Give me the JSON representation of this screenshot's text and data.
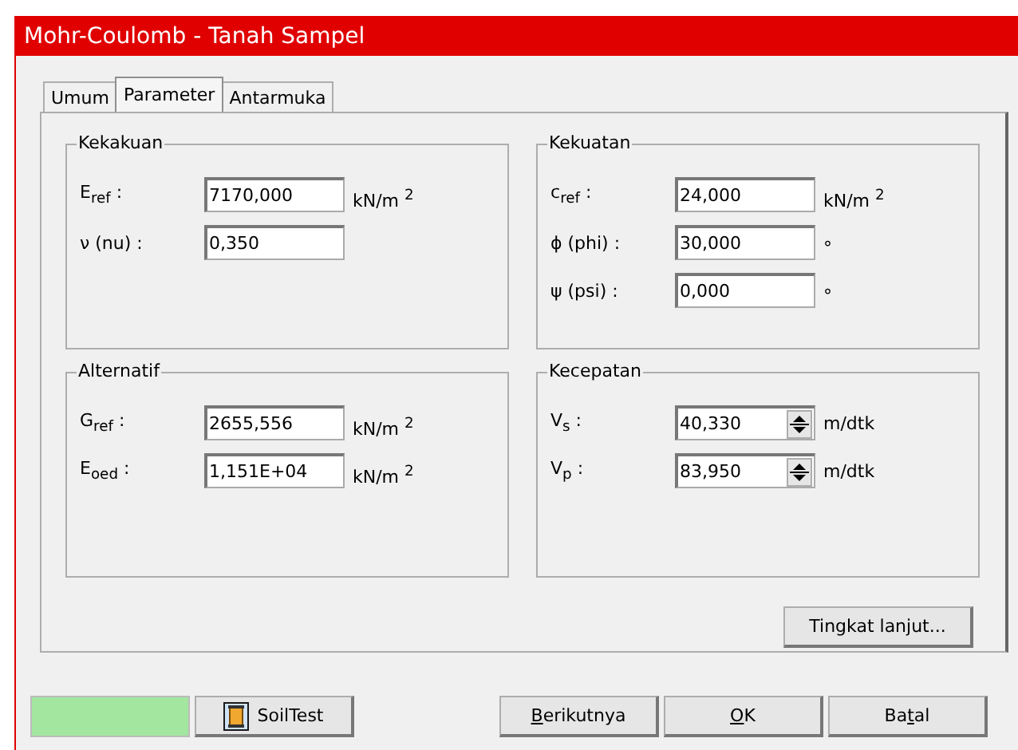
{
  "window": {
    "title": "Mohr-Coulomb - Tanah Sampel"
  },
  "tabs": [
    {
      "label": "Umum",
      "selected": false
    },
    {
      "label": "Parameter",
      "selected": true
    },
    {
      "label": "Antarmuka",
      "selected": false
    }
  ],
  "groups": [
    {
      "title": "Kekakuan",
      "fields": [
        {
          "kind": "text",
          "label": "E$_{ref}$ :",
          "value": "7170,000",
          "unit": "kN/m $^{2}$"
        },
        {
          "kind": "text",
          "label": "ν (nu) :",
          "value": "0,350"
        }
      ]
    },
    {
      "title": "Kekuatan",
      "fields": [
        {
          "kind": "text",
          "label": "c$_{ref}$ :",
          "value": "24,000",
          "unit": "kN/m $^{2}$"
        },
        {
          "kind": "text",
          "label": "ϕ (phi) :",
          "value": "30,000",
          "unit": "°"
        },
        {
          "kind": "text",
          "label": "ψ (psi) :",
          "value": "0,000",
          "unit": "°"
        }
      ]
    },
    {
      "title": "Alternatif",
      "fields": [
        {
          "kind": "text",
          "label": "G$_{ref}$ :",
          "value": "2655,556",
          "unit": "kN/m $^{2}$"
        },
        {
          "kind": "text",
          "label": "E$_{oed}$ :",
          "value": "1,151E+04",
          "unit": "kN/m $^{2}$"
        }
      ]
    },
    {
      "title": "Kecepatan",
      "fields": [
        {
          "kind": "spin",
          "label": "V$_{s}$ :",
          "value": "40,330",
          "unit": "m/dtk"
        },
        {
          "kind": "spin",
          "label": "V$_{p}$ :",
          "value": "83,950",
          "unit": "m/dtk"
        }
      ]
    }
  ],
  "advanced_button": "Tingkat lanjut...",
  "swatch": {
    "color": "#a3e6a0"
  },
  "soiltest_button": "SoilTest",
  "buttons": [
    {
      "key": "B",
      "after": "erikutnya"
    },
    {
      "key": "O",
      "after": "K"
    },
    {
      "before": "Ba",
      "key": "t",
      "after": "al"
    }
  ]
}
